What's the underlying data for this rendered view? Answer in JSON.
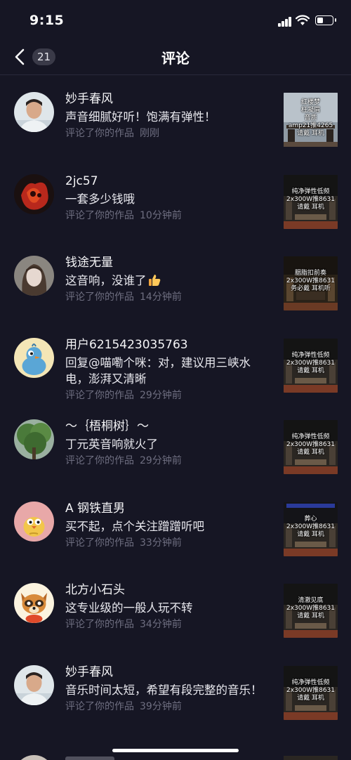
{
  "status_bar": {
    "time": "9:15"
  },
  "nav": {
    "back_count": "21",
    "title": "评论"
  },
  "comments": [
    {
      "name": "妙手春风",
      "text": "声音细腻好听！饱满有弹性！",
      "action": "评论了你的作品",
      "time": "刚刚",
      "thumb_text": "红楼梦\n枉凝眉\n音质\namp21推4265\n请戴  耳机",
      "thumb_style": "light",
      "avatar_icon": "man-portrait-avatar"
    },
    {
      "name": "2jc57",
      "text": "一套多少钱哦",
      "action": "评论了你的作品",
      "time": "10分钟前",
      "thumb_text": "纯净弹性低频\n2x300W推8631\n请戴  耳机",
      "thumb_style": "dark",
      "avatar_icon": "red-art-avatar"
    },
    {
      "name": "钱途无量",
      "text": "这音响，没谁了",
      "action": "评论了你的作品",
      "time": "14分钟前",
      "thumb_text": "胭脂扣前奏\n2x300W推8631\n务必戴  耳机听",
      "thumb_style": "dark",
      "avatar_icon": "woman-portrait-avatar",
      "emoji": "thumbs-up-icon"
    },
    {
      "name": "用户6215423035763",
      "text": "回复@喵嘞个咪：对，建议用三峡水电，澎湃又清晰",
      "action": "评论了你的作品",
      "time": "29分钟前",
      "thumb_text": "纯净弹性低频\n2x300W推8631\n请戴  耳机",
      "thumb_style": "dark",
      "avatar_icon": "cartoon-bird-avatar"
    },
    {
      "name": "～｛梧桐树｝～",
      "text": "丁元英音响就火了",
      "action": "评论了你的作品",
      "time": "29分钟前",
      "thumb_text": "纯净弹性低频\n2x300W推8631\n请戴  耳机",
      "thumb_style": "dark",
      "avatar_icon": "tree-avatar"
    },
    {
      "name": "A 钢铁直男",
      "text": "买不起，点个关注蹭蹭听吧",
      "action": "评论了你的作品",
      "time": "33分钟前",
      "thumb_text": "葬心\n2x300W推8631\n请戴  耳机",
      "thumb_style": "dark",
      "avatar_icon": "cartoon-chick-avatar"
    },
    {
      "name": "北方小石头",
      "text": "这专业级的一般人玩不转",
      "action": "评论了你的作品",
      "time": "34分钟前",
      "thumb_text": "清澈见底\n2x300W推8631\n请戴  耳机",
      "thumb_style": "dark",
      "avatar_icon": "cartoon-raccoon-avatar"
    },
    {
      "name": "妙手春风",
      "text": "音乐时间太短，希望有段完整的音乐！",
      "action": "评论了你的作品",
      "time": "39分钟前",
      "thumb_text": "纯净弹性低频\n2x300W推8631\n请戴  耳机",
      "thumb_style": "dark",
      "avatar_icon": "man-portrait-avatar"
    }
  ],
  "colors": {
    "background": "#161624",
    "meta_text": "#6e6e80",
    "badge": "#3a3a48"
  }
}
